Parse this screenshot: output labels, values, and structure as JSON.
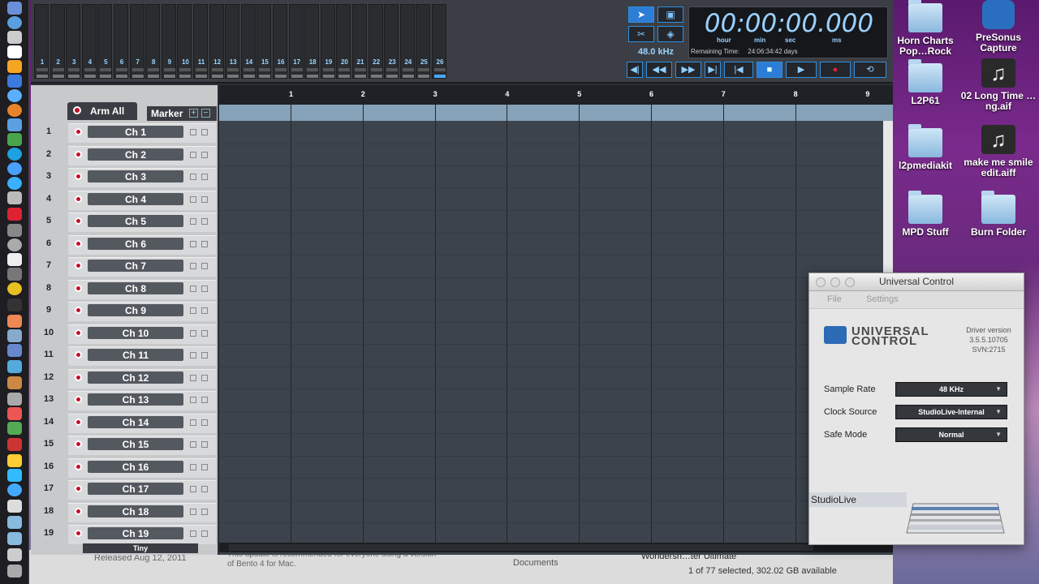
{
  "meters": [
    "1",
    "2",
    "3",
    "4",
    "5",
    "6",
    "7",
    "8",
    "9",
    "10",
    "11",
    "12",
    "13",
    "14",
    "15",
    "16",
    "17",
    "18",
    "19",
    "20",
    "21",
    "22",
    "23",
    "24",
    "25",
    "26"
  ],
  "transport": {
    "sample_rate": "48.0 kHz",
    "time": "00:00:00.000",
    "units": [
      "hour",
      "min",
      "sec",
      "ms"
    ],
    "remaining_label": "Remaining Time:",
    "remaining_value": "24:06:34:42 days"
  },
  "track_header": {
    "arm_all": "Arm All",
    "marker": "Marker",
    "plus": "+",
    "minus": "−",
    "size_label": "Tiny"
  },
  "tracks": [
    {
      "num": "1",
      "name": "Ch 1"
    },
    {
      "num": "2",
      "name": "Ch 2"
    },
    {
      "num": "3",
      "name": "Ch 3"
    },
    {
      "num": "4",
      "name": "Ch 4"
    },
    {
      "num": "5",
      "name": "Ch 5"
    },
    {
      "num": "6",
      "name": "Ch 6"
    },
    {
      "num": "7",
      "name": "Ch 7"
    },
    {
      "num": "8",
      "name": "Ch 8"
    },
    {
      "num": "9",
      "name": "Ch 9"
    },
    {
      "num": "10",
      "name": "Ch 10"
    },
    {
      "num": "11",
      "name": "Ch 11"
    },
    {
      "num": "12",
      "name": "Ch 12"
    },
    {
      "num": "13",
      "name": "Ch 13"
    },
    {
      "num": "14",
      "name": "Ch 14"
    },
    {
      "num": "15",
      "name": "Ch 15"
    },
    {
      "num": "16",
      "name": "Ch 16"
    },
    {
      "num": "17",
      "name": "Ch 17"
    },
    {
      "num": "18",
      "name": "Ch 18"
    },
    {
      "num": "19",
      "name": "Ch 19"
    }
  ],
  "ruler": [
    "1",
    "2",
    "3",
    "4",
    "5",
    "6",
    "7",
    "8",
    "9"
  ],
  "desktop": [
    {
      "label": "Horn Charts Pop…Rock",
      "kind": "folder"
    },
    {
      "label": "PreSonus Capture",
      "kind": "app"
    },
    {
      "label": "L2P61",
      "kind": "folder"
    },
    {
      "label": "02 Long Time …ng.aif",
      "kind": "audio"
    },
    {
      "label": "l2pmediakit",
      "kind": "folder"
    },
    {
      "label": "make me smile edit.aiff",
      "kind": "audio"
    },
    {
      "label": "MPD Stuff",
      "kind": "folder"
    },
    {
      "label": "Burn Folder",
      "kind": "burn"
    }
  ],
  "finder_strip": {
    "released": "Released Aug 12, 2011",
    "update_note_1": "This update is recommended for everyone using a version",
    "update_note_2": "of Bento 4 for Mac.",
    "documents": "Documents",
    "wondershare": "Wondersh…ter Ultimate",
    "status": "1 of 77 selected, 302.02 GB available"
  },
  "universal_control": {
    "title": "Universal Control",
    "menu_file": "File",
    "menu_settings": "Settings",
    "logo_line1": "UNIVERSAL",
    "logo_line2": "CONTROL",
    "driver_label": "Driver version",
    "driver_version": "3.5.5.10705",
    "driver_svn": "SVN:2715",
    "sample_rate_label": "Sample Rate",
    "sample_rate_value": "48 KHz",
    "clock_source_label": "Clock Source",
    "clock_source_value": "StudioLive-Internal",
    "safe_mode_label": "Safe Mode",
    "safe_mode_value": "Normal",
    "device": "StudioLive"
  }
}
